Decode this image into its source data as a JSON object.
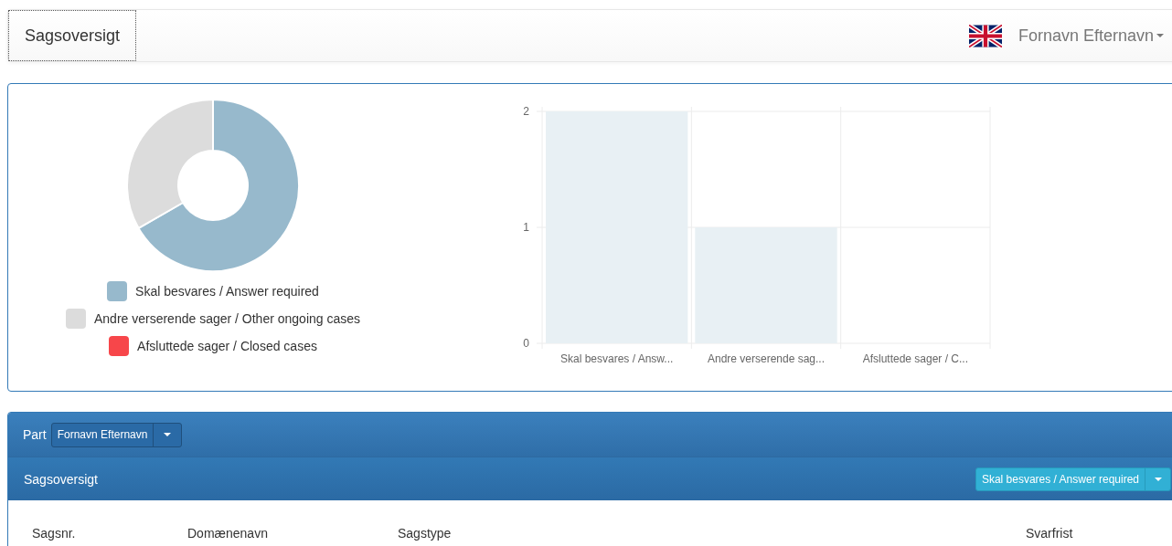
{
  "navbar": {
    "brand": "Sagsoversigt",
    "user": "Fornavn Efternavn"
  },
  "donut": {
    "chart_data": {
      "type": "donut",
      "categories": [
        "Skal besvares / Answer required",
        "Andre verserende sager / Other ongoing cases",
        "Afsluttede sager / Closed cases"
      ],
      "values": [
        66.67,
        33.33,
        0
      ]
    },
    "legend": [
      {
        "color": "#97b9cc"
      },
      {
        "color": "#dcdcdc"
      },
      {
        "color": "#f7464a"
      }
    ]
  },
  "bars": {
    "chart_data": {
      "type": "bar",
      "categories": [
        "Skal besvares / Answ...",
        "Andre verserende sag...",
        "Afsluttede sager / C..."
      ],
      "series": [
        {
          "color": "#e8f0f4",
          "values": [
            2,
            1,
            0
          ]
        }
      ],
      "ylim": [
        0,
        2
      ],
      "yticks": [
        0,
        1,
        2
      ]
    }
  },
  "cases": {
    "part_label": "Part",
    "part_select": "Fornavn Efternavn",
    "heading": "Sagsoversigt",
    "filter": "Skal besvares / Answer required",
    "columns": [
      "Sagsnr.",
      "Domænenavn",
      "Sagstype",
      "Svarfrist"
    ]
  }
}
